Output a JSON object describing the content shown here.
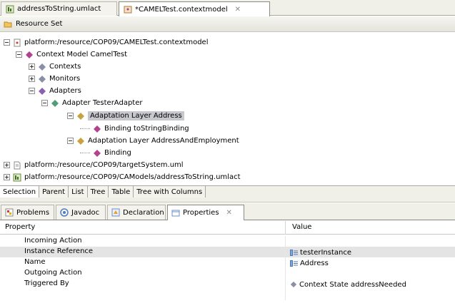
{
  "editor_tabs": [
    {
      "label": "addressToString.umlact",
      "icon": "uml-activity-icon"
    },
    {
      "label": "*CAMELTest.contextmodel",
      "icon": "context-model-icon",
      "close": "✕"
    }
  ],
  "resource_set": {
    "label": "Resource Set"
  },
  "tree": {
    "root": "platform:/resource/COP09/CAMELTest.contextmodel",
    "context_model": "Context Model CamelTest",
    "contexts": "Contexts",
    "monitors": "Monitors",
    "adapters": "Adapters",
    "adapter": "Adapter TesterAdapter",
    "layer_address": "Adaptation Layer Address",
    "binding_tostring": "Binding toStringBinding",
    "layer_address_employment": "Adaptation Layer AddressAndEmployment",
    "binding": "Binding",
    "target_system": "platform:/resource/COP09/targetSystem.uml",
    "address_to_string": "platform:/resource/COP09/CAModels/addressToString.umlact"
  },
  "view_tabs": [
    "Selection",
    "Parent",
    "List",
    "Tree",
    "Table",
    "Tree with Columns"
  ],
  "panel_tabs": [
    {
      "label": "Problems",
      "icon": "problems-icon"
    },
    {
      "label": "Javadoc",
      "icon": "javadoc-icon"
    },
    {
      "label": "Declaration",
      "icon": "declaration-icon"
    },
    {
      "label": "Properties",
      "icon": "properties-icon",
      "close": "✕"
    }
  ],
  "properties": {
    "header_property": "Property",
    "header_value": "Value",
    "rows": [
      {
        "name": "Incoming Action",
        "value": ""
      },
      {
        "name": "Instance Reference",
        "value": "testerInstance"
      },
      {
        "name": "Name",
        "value": "Address"
      },
      {
        "name": "Outgoing Action",
        "value": ""
      },
      {
        "name": "Triggered By",
        "value": "Context State addressNeeded"
      }
    ]
  },
  "colors": {
    "diamond_purple": "#b0428f",
    "diamond_green": "#4f9e78",
    "diamond_gold": "#c8a23c",
    "selection": "#c7c7ce"
  }
}
